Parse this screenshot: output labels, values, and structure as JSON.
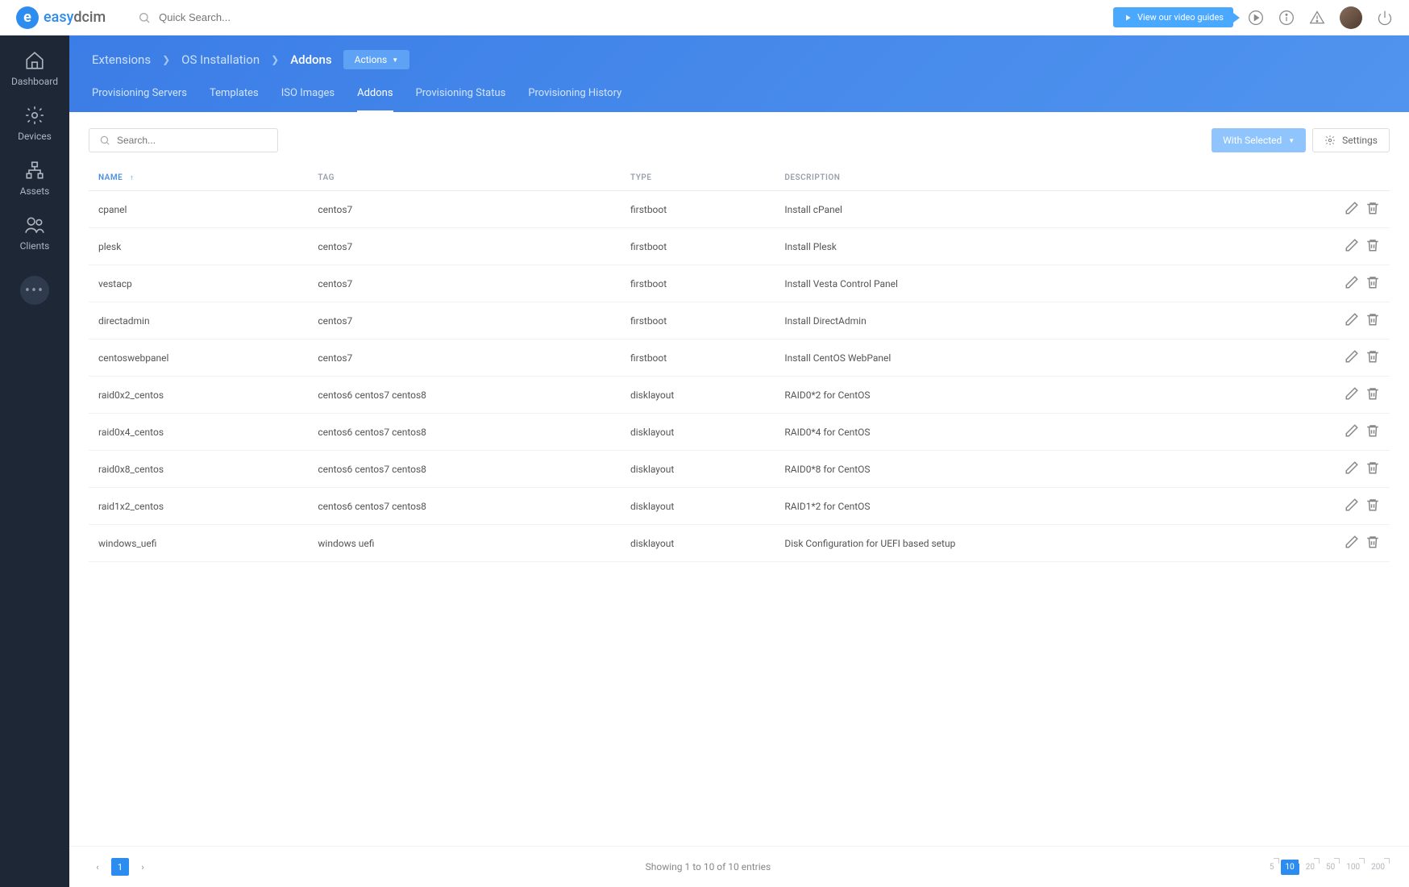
{
  "logo": {
    "part1": "easy",
    "part2": "dcim"
  },
  "quick_search_placeholder": "Quick Search...",
  "topbar": {
    "video_guides": "View our video guides"
  },
  "sidebar": {
    "items": [
      {
        "label": "Dashboard"
      },
      {
        "label": "Devices"
      },
      {
        "label": "Assets"
      },
      {
        "label": "Clients"
      }
    ]
  },
  "breadcrumb": {
    "items": [
      "Extensions",
      "OS Installation",
      "Addons"
    ],
    "actions_label": "Actions"
  },
  "tabs": [
    {
      "label": "Provisioning Servers",
      "active": false
    },
    {
      "label": "Templates",
      "active": false
    },
    {
      "label": "ISO Images",
      "active": false
    },
    {
      "label": "Addons",
      "active": true
    },
    {
      "label": "Provisioning Status",
      "active": false
    },
    {
      "label": "Provisioning History",
      "active": false
    }
  ],
  "toolbar": {
    "search_placeholder": "Search...",
    "with_selected": "With Selected",
    "settings": "Settings"
  },
  "table": {
    "headers": {
      "name": "NAME",
      "tag": "TAG",
      "type": "TYPE",
      "description": "DESCRIPTION"
    },
    "rows": [
      {
        "name": "cpanel",
        "tag": "centos7",
        "type": "firstboot",
        "description": "Install cPanel"
      },
      {
        "name": "plesk",
        "tag": "centos7",
        "type": "firstboot",
        "description": "Install Plesk"
      },
      {
        "name": "vestacp",
        "tag": "centos7",
        "type": "firstboot",
        "description": "Install Vesta Control Panel"
      },
      {
        "name": "directadmin",
        "tag": "centos7",
        "type": "firstboot",
        "description": "Install DirectAdmin"
      },
      {
        "name": "centoswebpanel",
        "tag": "centos7",
        "type": "firstboot",
        "description": "Install CentOS WebPanel"
      },
      {
        "name": "raid0x2_centos",
        "tag": "centos6 centos7 centos8",
        "type": "disklayout",
        "description": "RAID0*2 for CentOS"
      },
      {
        "name": "raid0x4_centos",
        "tag": "centos6 centos7 centos8",
        "type": "disklayout",
        "description": "RAID0*4 for CentOS"
      },
      {
        "name": "raid0x8_centos",
        "tag": "centos6 centos7 centos8",
        "type": "disklayout",
        "description": "RAID0*8 for CentOS"
      },
      {
        "name": "raid1x2_centos",
        "tag": "centos6 centos7 centos8",
        "type": "disklayout",
        "description": "RAID1*2 for CentOS"
      },
      {
        "name": "windows_uefi",
        "tag": "windows uefi",
        "type": "disklayout",
        "description": "Disk Configuration for UEFI based setup"
      }
    ]
  },
  "footer": {
    "showing": "Showing 1 to 10 of 10 entries",
    "current_page": "1",
    "page_sizes": [
      "5",
      "10",
      "20",
      "50",
      "100",
      "200"
    ],
    "active_size": "10"
  }
}
